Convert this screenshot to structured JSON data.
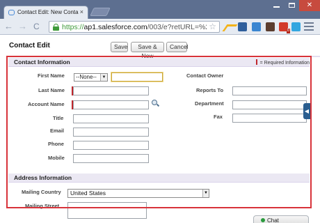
{
  "browser": {
    "tab_title": "Contact Edit: New Contac",
    "tab_close": "×",
    "url_scheme": "https://",
    "url_host": "ap1.salesforce.com",
    "url_path": "/003/e?retURL=%2F003%",
    "nav_back": "←",
    "nav_forward": "→",
    "nav_reload": "C",
    "bookmark_star": "☆",
    "window_close": "✕",
    "ext_badge": "0"
  },
  "page": {
    "title": "Contact Edit",
    "buttons": {
      "save": "Save",
      "save_new": "Save & New",
      "cancel": "Cancel"
    },
    "contact_section": {
      "title": "Contact Information",
      "required_legend": "= Required Information",
      "fields": {
        "first_name": "First Name",
        "salutation_value": "--None--",
        "last_name": "Last Name",
        "account_name": "Account Name",
        "title": "Title",
        "email": "Email",
        "phone": "Phone",
        "mobile": "Mobile",
        "contact_owner": "Contact Owner",
        "reports_to": "Reports To",
        "department": "Department",
        "fax": "Fax"
      }
    },
    "address_section": {
      "title": "Address Information",
      "mailing_country": "Mailing Country",
      "mailing_country_value": "United States",
      "mailing_street": "Mailing Street"
    },
    "side_tab_arrow": "◀",
    "chat_label": "Chat"
  }
}
